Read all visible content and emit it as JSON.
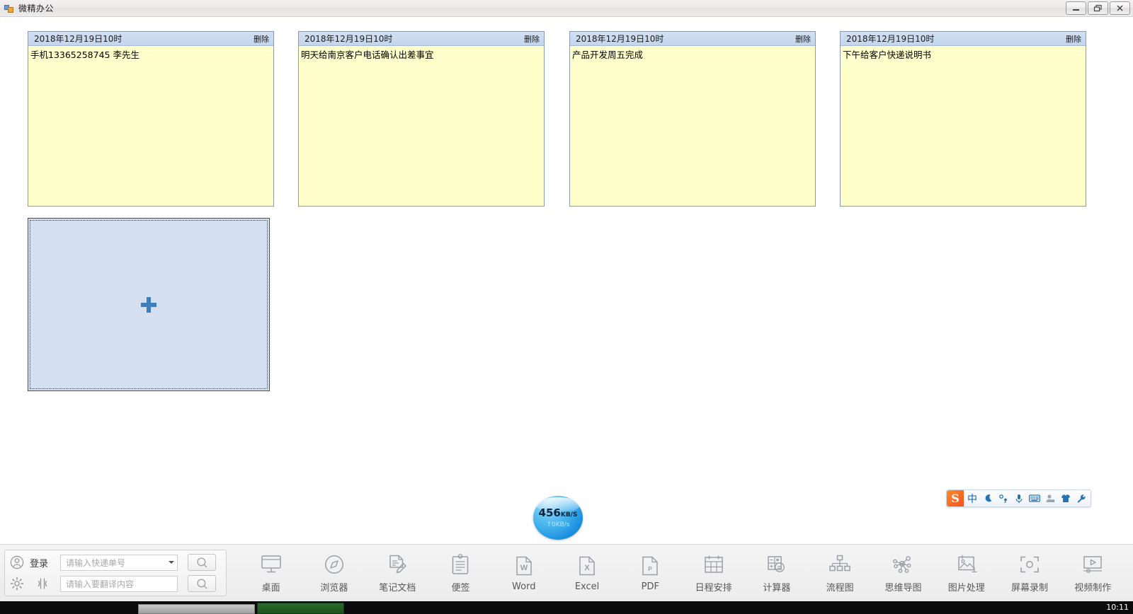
{
  "window": {
    "title": "微精办公",
    "app_icon": "app-window-icon",
    "buttons": [
      {
        "name": "minimize-button",
        "label": "—"
      },
      {
        "name": "restore-button",
        "label": "❐"
      },
      {
        "name": "close-button",
        "label": "✕"
      }
    ]
  },
  "notes": [
    {
      "date": "2018年12月19日10时",
      "delete_label": "删除",
      "text": "手机13365258745 李先生"
    },
    {
      "date": "2018年12月19日10时",
      "delete_label": "删除",
      "text": "明天给南京客户电话确认出差事宜"
    },
    {
      "date": "2018年12月19日10时",
      "delete_label": "删除",
      "text": "产品开发周五完成"
    },
    {
      "date": "2018年12月19日10时",
      "delete_label": "删除",
      "text": "下午给客户快递说明书"
    }
  ],
  "add_note": {
    "icon": "plus-icon",
    "tooltip": ""
  },
  "netspeed": {
    "download": "456",
    "download_unit": "KB/S",
    "upload": "↑0KB/s"
  },
  "sogou": {
    "logo": "S",
    "items": [
      {
        "name": "sogou-mode-chinese",
        "label": "中"
      },
      {
        "name": "sogou-moon-icon",
        "label": ""
      },
      {
        "name": "sogou-punctuation-icon",
        "label": ""
      },
      {
        "name": "sogou-microphone-icon",
        "label": ""
      },
      {
        "name": "sogou-keyboard-icon",
        "label": ""
      },
      {
        "name": "sogou-user-icon",
        "label": ""
      },
      {
        "name": "sogou-skin-icon",
        "label": ""
      },
      {
        "name": "sogou-toolbox-icon",
        "label": ""
      }
    ]
  },
  "dock": {
    "login_label": "登录",
    "express": {
      "placeholder": "请输入快递单号",
      "value": "",
      "search_icon": "search-icon"
    },
    "translate": {
      "placeholder": "请输入要翻译内容",
      "value": "",
      "search_icon": "search-icon"
    },
    "settings_icon": "gear-icon",
    "translate_icon": "translate-icon",
    "account_icon": "user-circle-icon",
    "items": [
      {
        "label": "桌面",
        "icon": "monitor-icon"
      },
      {
        "label": "浏览器",
        "icon": "compass-icon"
      },
      {
        "label": "笔记文档",
        "icon": "note-pencil-icon"
      },
      {
        "label": "便签",
        "icon": "clipboard-icon"
      },
      {
        "label": "Word",
        "icon": "word-icon"
      },
      {
        "label": "Excel",
        "icon": "excel-icon"
      },
      {
        "label": "PDF",
        "icon": "pdf-icon"
      },
      {
        "label": "日程安排",
        "icon": "calendar-icon"
      },
      {
        "label": "计算器",
        "icon": "calculator-icon"
      },
      {
        "label": "流程图",
        "icon": "flowchart-icon"
      },
      {
        "label": "思维导图",
        "icon": "mindmap-icon"
      },
      {
        "label": "图片处理",
        "icon": "image-icon"
      },
      {
        "label": "屏幕录制",
        "icon": "screen-record-icon"
      },
      {
        "label": "视频制作",
        "icon": "video-icon"
      }
    ]
  },
  "taskbar": {
    "clock": "10:11"
  }
}
